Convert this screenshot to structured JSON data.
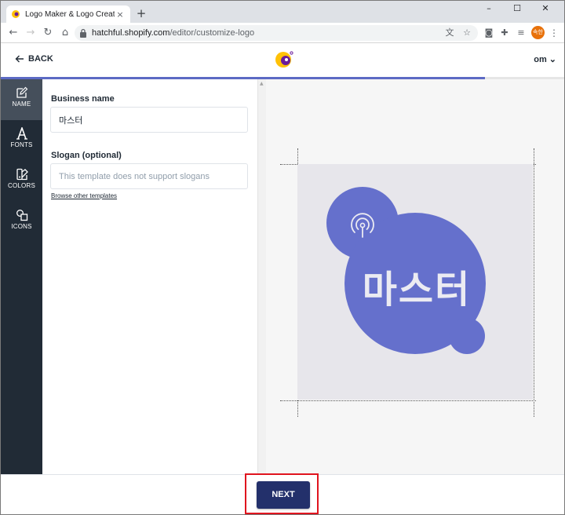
{
  "browser": {
    "tab_title": "Logo Maker & Logo Creator - F",
    "tab_close": "×",
    "new_tab": "+",
    "url_host": "hatchful.shopify.com",
    "url_path": "/editor/customize-logo",
    "profile_initials": "속한",
    "window_controls": [
      "–",
      "☐",
      "✕"
    ]
  },
  "header": {
    "back_label": "BACK",
    "account_label": "om ⌄"
  },
  "progress": {
    "fraction": 0.86,
    "color": "#5c6ac4"
  },
  "sidebar": {
    "items": [
      {
        "label": "NAME",
        "icon": "edit-icon",
        "active": true
      },
      {
        "label": "FONTS",
        "icon": "font-icon",
        "active": false
      },
      {
        "label": "COLORS",
        "icon": "palette-icon",
        "active": false
      },
      {
        "label": "ICONS",
        "icon": "shapes-icon",
        "active": false
      }
    ]
  },
  "form": {
    "business_name_label": "Business name",
    "business_name_value": "마스터",
    "slogan_label": "Slogan (optional)",
    "slogan_placeholder": "This template does not support slogans",
    "browse_link": "Browse other templates"
  },
  "preview": {
    "logo_text": "마스터",
    "shape_color": "#6570cc",
    "canvas_color": "#e7e6eb",
    "icon": "broadcast-icon"
  },
  "footer": {
    "next_label": "NEXT"
  },
  "colors": {
    "sidebar_bg": "#212b36",
    "sidebar_active": "#454f5b",
    "next_bg": "#23306b",
    "highlight": "#e0141e"
  }
}
